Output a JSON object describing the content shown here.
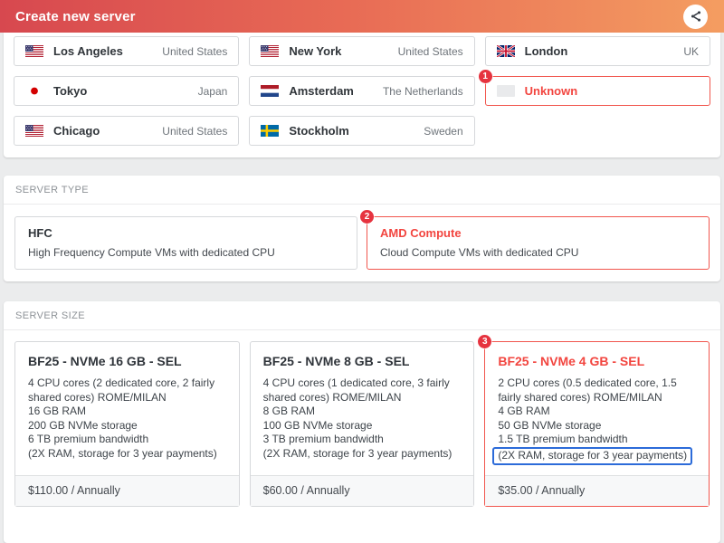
{
  "header": {
    "title": "Create new server"
  },
  "colors": {
    "header_gradient_left": "#d7484f",
    "header_gradient_right": "#f49d61",
    "accent_red": "#f2453f",
    "badge_red": "#e6333f",
    "annotation_blue": "#2c6bd9"
  },
  "locations": [
    {
      "city": "Los Angeles",
      "country": "United States",
      "flag": "us",
      "selected": false,
      "badge": ""
    },
    {
      "city": "New York",
      "country": "United States",
      "flag": "us",
      "selected": false,
      "badge": ""
    },
    {
      "city": "London",
      "country": "UK",
      "flag": "uk",
      "selected": false,
      "badge": ""
    },
    {
      "city": "Tokyo",
      "country": "Japan",
      "flag": "jp",
      "selected": false,
      "badge": ""
    },
    {
      "city": "Amsterdam",
      "country": "The Netherlands",
      "flag": "nl",
      "selected": false,
      "badge": ""
    },
    {
      "city": "Unknown",
      "country": "",
      "flag": "unknown",
      "selected": true,
      "badge": "1"
    },
    {
      "city": "Chicago",
      "country": "United States",
      "flag": "us",
      "selected": false,
      "badge": ""
    },
    {
      "city": "Stockholm",
      "country": "Sweden",
      "flag": "se",
      "selected": false,
      "badge": ""
    }
  ],
  "server_type": {
    "label": "SERVER TYPE",
    "options": [
      {
        "name": "HFC",
        "description": "High Frequency Compute VMs with dedicated CPU",
        "selected": false,
        "badge": ""
      },
      {
        "name": "AMD Compute",
        "description": "Cloud Compute VMs with dedicated CPU",
        "selected": true,
        "badge": "2"
      }
    ]
  },
  "server_size": {
    "label": "SERVER SIZE",
    "options": [
      {
        "name": "BF25 - NVMe 16 GB - SEL",
        "specs": [
          "4 CPU cores (2 dedicated core, 2 fairly shared cores) ROME/MILAN",
          "16 GB RAM",
          "200 GB NVMe storage",
          "6 TB premium bandwidth",
          "(2X RAM, storage for 3 year payments)"
        ],
        "price": "$110.00 / Annually",
        "selected": false,
        "badge": "",
        "highlighted_spec_index": -1
      },
      {
        "name": "BF25 - NVMe 8 GB - SEL",
        "specs": [
          "4 CPU cores (1 dedicated core, 3 fairly shared cores) ROME/MILAN",
          "8 GB RAM",
          "100 GB NVMe storage",
          "3 TB premium bandwidth",
          "(2X RAM, storage for 3 year payments)"
        ],
        "price": "$60.00 / Annually",
        "selected": false,
        "badge": "",
        "highlighted_spec_index": -1
      },
      {
        "name": "BF25 - NVMe 4 GB - SEL",
        "specs": [
          "2 CPU cores (0.5 dedicated core, 1.5 fairly shared cores) ROME/MILAN",
          "4 GB RAM",
          "50 GB NVMe storage",
          "1.5 TB premium bandwidth",
          "(2X RAM, storage for 3 year payments)"
        ],
        "price": "$35.00 / Annually",
        "selected": true,
        "badge": "3",
        "highlighted_spec_index": 4
      }
    ]
  }
}
